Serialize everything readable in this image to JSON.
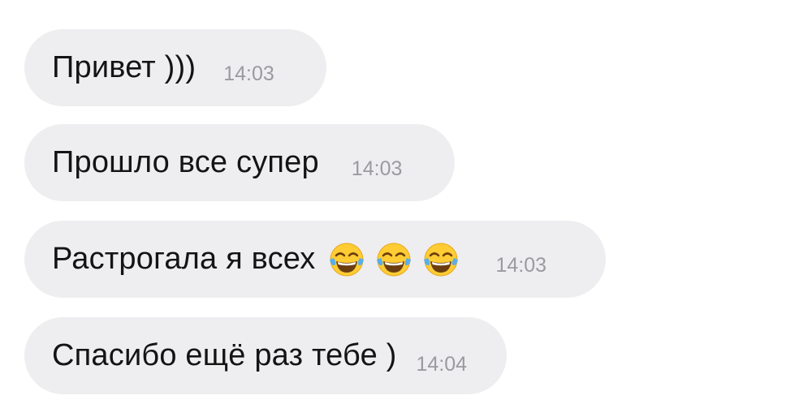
{
  "messages": [
    {
      "text": "Привет )))",
      "time": "14:03",
      "emojis": []
    },
    {
      "text": "Прошло все супер",
      "time": "14:03",
      "emojis": []
    },
    {
      "text": "Растрогала я всех",
      "time": "14:03",
      "emojis": [
        "face-with-tears-of-joy-icon",
        "face-with-tears-of-joy-icon",
        "face-with-tears-of-joy-icon"
      ]
    },
    {
      "text": "Спасибо ещё раз тебе )",
      "time": "14:04",
      "emojis": []
    }
  ],
  "colors": {
    "bubble_bg": "#eeeef0",
    "text": "#141414",
    "time": "#9a9aa0",
    "emoji_face": "#ffcc33",
    "emoji_tears": "#5aaee8"
  }
}
